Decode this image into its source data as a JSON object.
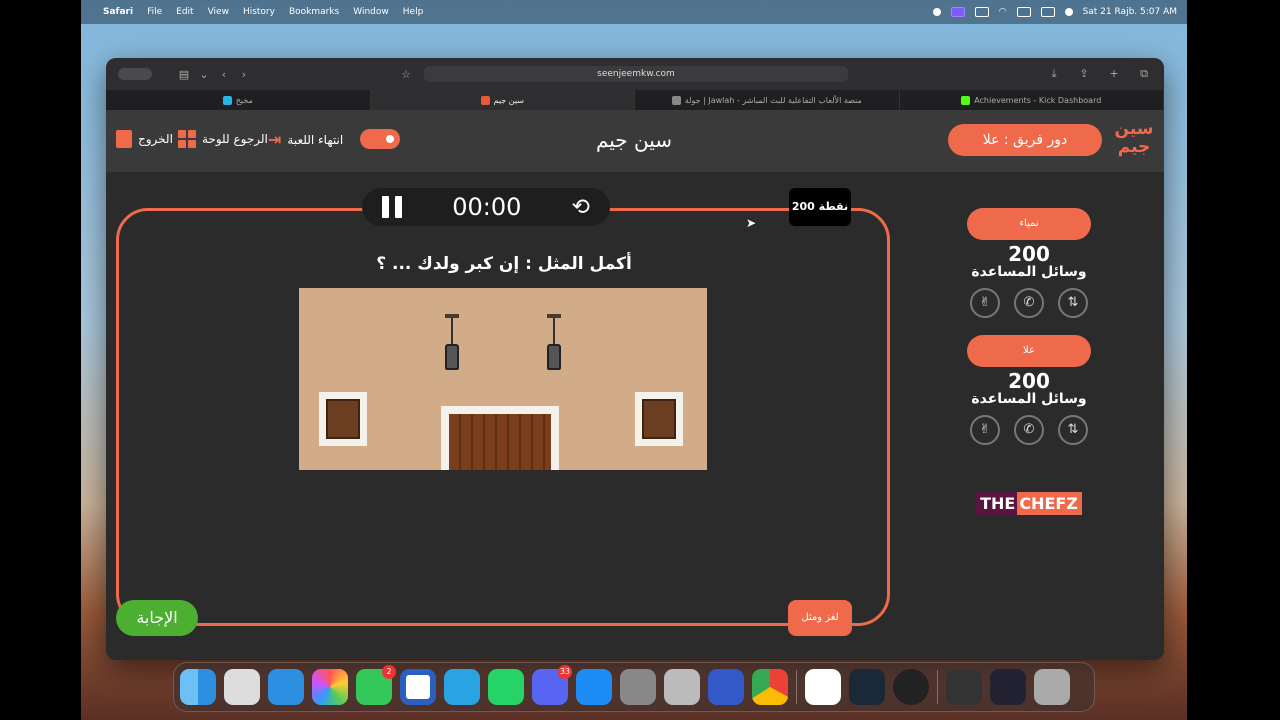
{
  "menubar": {
    "app": "Safari",
    "items": [
      "File",
      "Edit",
      "View",
      "History",
      "Bookmarks",
      "Window",
      "Help"
    ],
    "datetime": "Sat 21 Rajb.  5:07 AM"
  },
  "browser": {
    "url": "seenjeemkw.com",
    "tabs": [
      {
        "label": "مخيخ"
      },
      {
        "label": "سين جيم"
      },
      {
        "label": "جولة | Jawlah - منصة الألعاب التفاعلية للبث المباشر"
      },
      {
        "label": "Achievements - Kick Dashboard"
      }
    ]
  },
  "header": {
    "exit_label": "الخروج",
    "board_label": "الرجوع للوحة",
    "end_game_label": "انتهاء اللعبة",
    "title": "سين جيم",
    "turn_label": "دور فريق : علا",
    "logo_text": "سين جيم"
  },
  "game": {
    "timer": "00:00",
    "points": "200 نقطة",
    "question": "أكمل المثل : إن كبر ولدك ... ؟",
    "answer_label": "الإجابة",
    "category_label": "لغز ومثل"
  },
  "teams": [
    {
      "name": "نمياء",
      "score": "200",
      "helps_label": "وسائل المساعدة"
    },
    {
      "name": "علا",
      "score": "200",
      "helps_label": "وسائل المساعدة"
    }
  ],
  "sponsor": {
    "part1": "THE",
    "part2": "CHEFZ"
  },
  "dock": {
    "facetime_badge": "2",
    "discord_badge": "33"
  },
  "colors": {
    "accent": "#ef6a4b",
    "answer": "#4caf32",
    "panel": "#2b2b2b"
  }
}
